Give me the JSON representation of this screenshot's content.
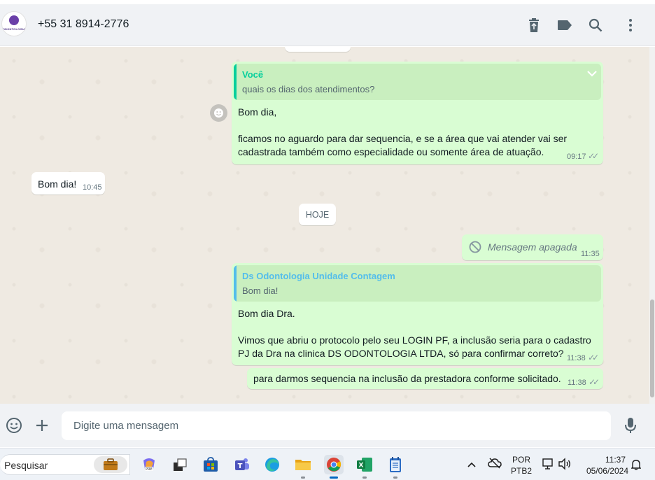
{
  "header": {
    "contact_name": "+55 31 8914-2776",
    "avatar_logo_text": "ODONTOLOGIA",
    "icons": [
      "delete-icon",
      "label-icon",
      "search-icon",
      "menu-icon"
    ]
  },
  "chat": {
    "messages": [
      {
        "direction": "outgoing",
        "quote": {
          "author": "Você",
          "text": "quais os dias dos atendimentos?",
          "author_color": "#06cf9c"
        },
        "lines": [
          "Bom dia,",
          "",
          "ficamos no aguardo para dar sequencia, e se a área que vai atender vai ser",
          "cadastrada também como especialidade ou somente área de atuação."
        ],
        "time": "09:17",
        "status": "read"
      },
      {
        "direction": "incoming",
        "text": "Bom dia!",
        "time": "10:45"
      },
      {
        "type": "date_divider",
        "label": "HOJE"
      },
      {
        "direction": "outgoing",
        "deleted": true,
        "text": "Mensagem apagada",
        "time": "11:35"
      },
      {
        "direction": "outgoing",
        "quote": {
          "author": "Ds Odontologia Unidade Contagem",
          "text": "Bom dia!",
          "author_color": "#53bdeb"
        },
        "lines": [
          "Bom dia Dra.",
          "",
          "Vimos que abriu o protocolo pelo seu LOGIN PF, a inclusão seria para o cadastro",
          "PJ da Dra na clinica DS ODONTOLOGIA LTDA, só para confirmar correto?"
        ],
        "time": "11:38",
        "status": "read"
      },
      {
        "direction": "outgoing",
        "text": "para darmos sequencia na inclusão da prestadora conforme solicitado.",
        "time": "11:38",
        "status": "read"
      }
    ]
  },
  "composer": {
    "placeholder": "Digite uma mensagem"
  },
  "taskbar": {
    "search_placeholder": "Pesquisar",
    "apps": [
      "copilot",
      "task-view",
      "store",
      "teams",
      "edge",
      "file-explorer",
      "chrome",
      "excel",
      "notepad"
    ],
    "active_app": "chrome",
    "lang_top": "POR",
    "lang_bottom": "PTB2",
    "time": "11:37",
    "date": "05/06/2024"
  },
  "colors": {
    "outgoing_bubble": "#d9fdd3",
    "incoming_bubble": "#ffffff",
    "chat_bg": "#efeae2",
    "header_bg": "#f0f2f5"
  }
}
